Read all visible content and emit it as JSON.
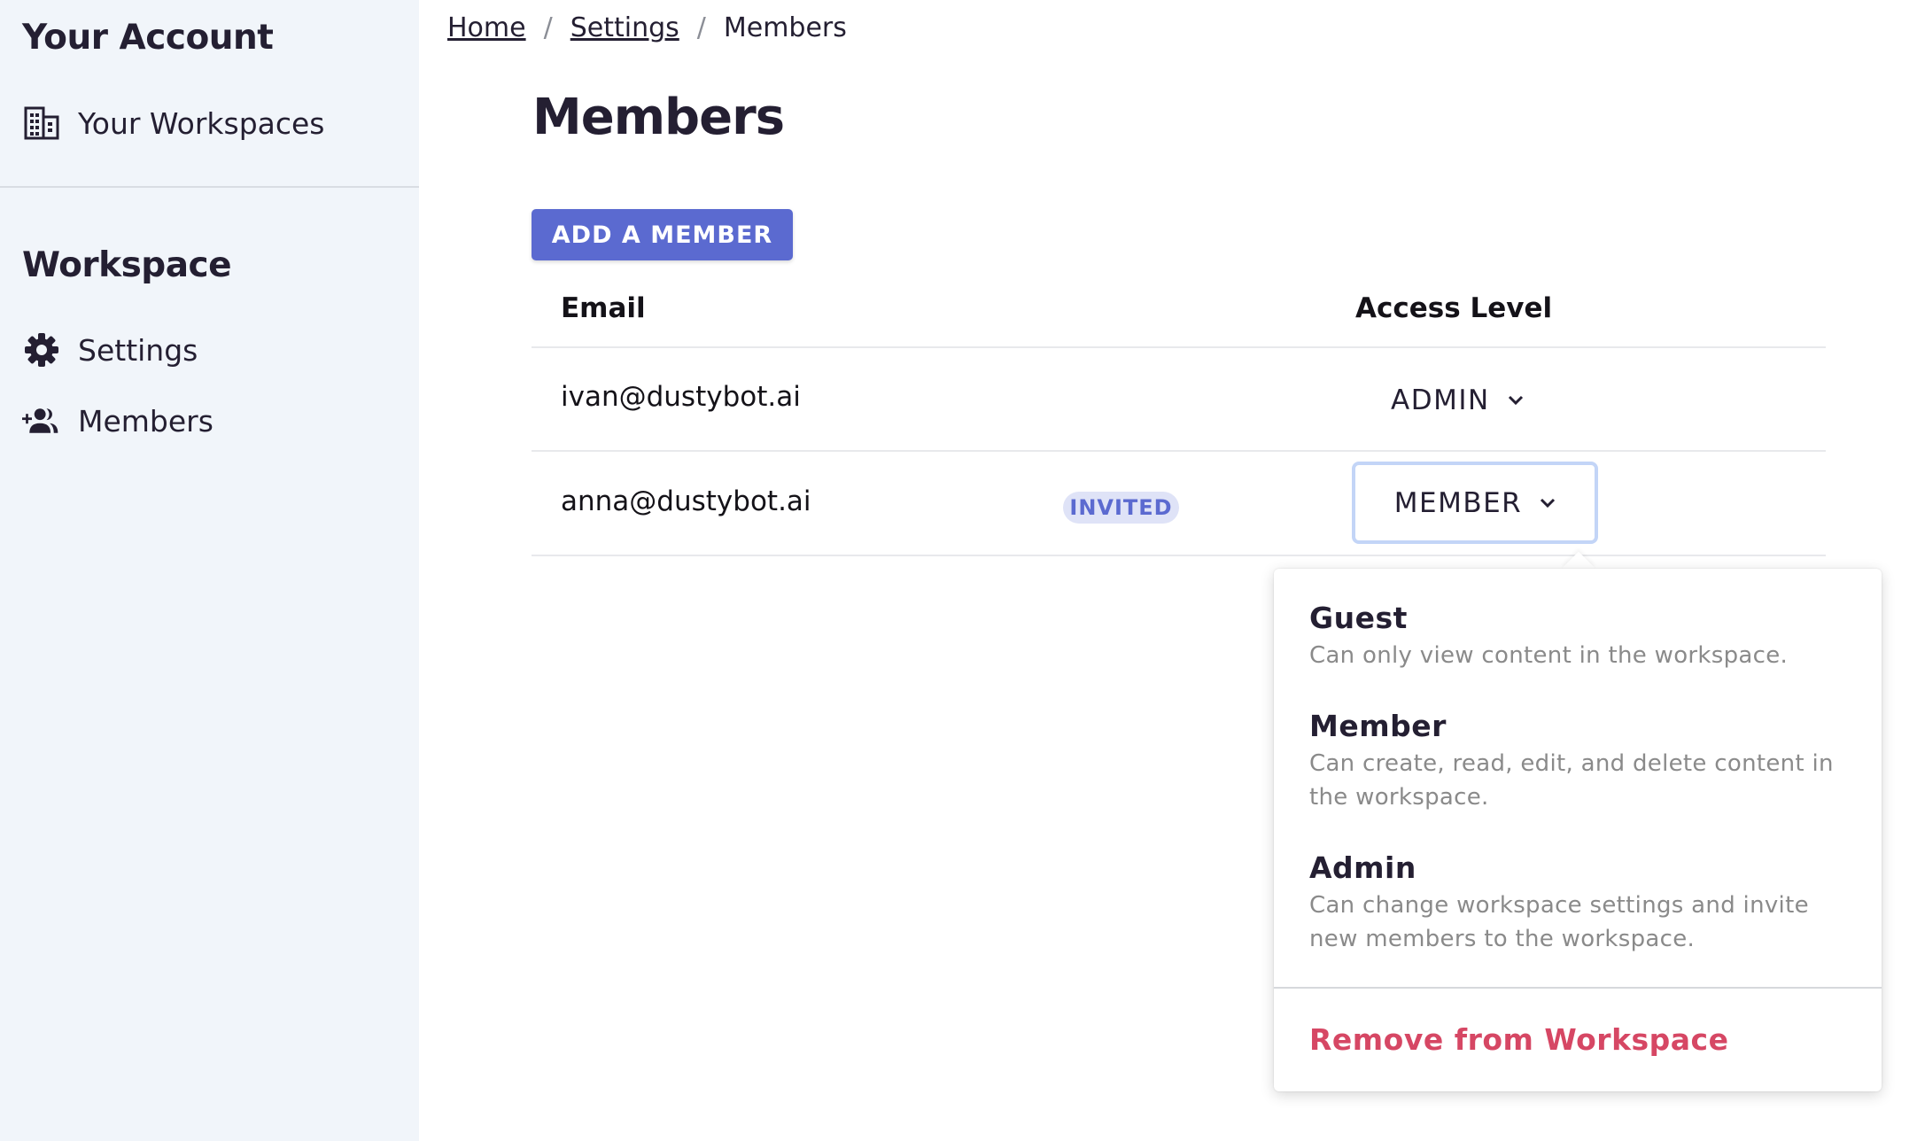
{
  "sidebar": {
    "account_title": "Your Account",
    "account_items": [
      {
        "label": "Your Workspaces",
        "icon": "building-icon"
      }
    ],
    "workspace_title": "Workspace",
    "workspace_items": [
      {
        "label": "Settings",
        "icon": "gear-icon"
      },
      {
        "label": "Members",
        "icon": "add-user-icon"
      }
    ]
  },
  "breadcrumb": {
    "items": [
      "Home",
      "Settings",
      "Members"
    ],
    "separator": "/"
  },
  "page": {
    "title": "Members",
    "add_button": "ADD A MEMBER"
  },
  "table": {
    "headers": {
      "email": "Email",
      "access": "Access Level"
    },
    "rows": [
      {
        "email": "ivan@dustybot.ai",
        "status": "",
        "access": "ADMIN"
      },
      {
        "email": "anna@dustybot.ai",
        "status": "INVITED",
        "access": "MEMBER"
      }
    ]
  },
  "dropdown": {
    "options": [
      {
        "title": "Guest",
        "description": "Can only view content in the workspace."
      },
      {
        "title": "Member",
        "description": "Can create, read, edit, and delete content in the workspace."
      },
      {
        "title": "Admin",
        "description": "Can change workspace settings and invite new members to the workspace."
      }
    ],
    "remove_label": "Remove from Workspace"
  },
  "colors": {
    "accent": "#5b6ad0",
    "danger": "#d64764",
    "sidebar_bg": "#f1f5fa"
  }
}
